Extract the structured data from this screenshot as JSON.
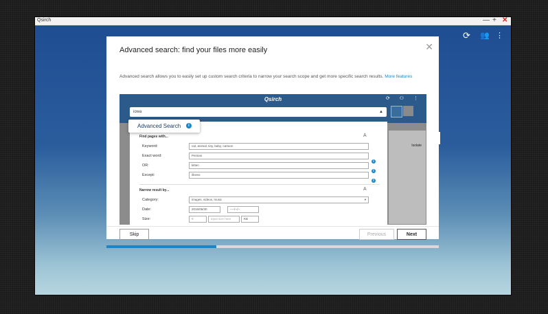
{
  "window": {
    "title": "Qsirch",
    "controls": {
      "minimize": "—",
      "maximize": "+",
      "close": "✕"
    }
  },
  "toolbar": {
    "icons": [
      "refresh-icon",
      "user-group-icon",
      "more-icon"
    ]
  },
  "modal": {
    "title": "Advanced search: find your files more easily",
    "description": "Advanced search allows you to easily set up custom search criteria to narrow your search scope and get more specific search results.",
    "more_link": "More features",
    "screenshot": {
      "logo": "Qsirch",
      "search_value": "iowa",
      "side_label": "Isolate",
      "advanced_tab": "Advanced Search",
      "find_section": "Find pages with...",
      "fields": [
        {
          "label": "Keyword:",
          "value": "cat, animal, tiny, baby, cartoon"
        },
        {
          "label": "Exact word:",
          "value": "Persian"
        },
        {
          "label": "OR:",
          "value": "kitten"
        },
        {
          "label": "Except:",
          "value": "illness"
        }
      ],
      "narrow_section": "Narrow result by...",
      "category_label": "Category:",
      "category_value": "images, videos, music",
      "date_label": "Date:",
      "date_from": "2016/06/30",
      "date_to": "----/--/--",
      "size_label": "Size:",
      "size_operator": "<",
      "size_placeholder": "input size here",
      "size_unit": "KB"
    },
    "buttons": {
      "skip": "Skip",
      "previous": "Previous",
      "next": "Next"
    },
    "progress": 0.33
  }
}
